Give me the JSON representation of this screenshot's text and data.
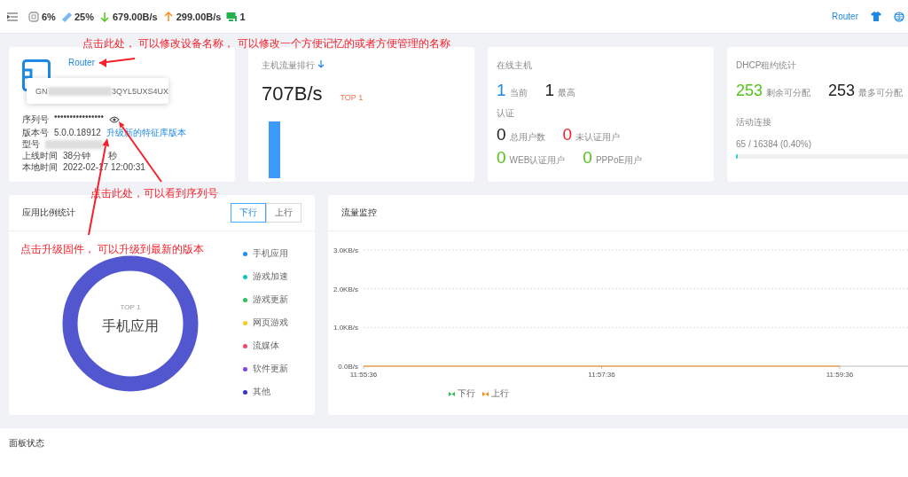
{
  "topbar": {
    "stats": [
      {
        "kind": "cpu",
        "value": "6%"
      },
      {
        "kind": "memory",
        "value": "25%"
      },
      {
        "kind": "down",
        "value": "679.00B/s"
      },
      {
        "kind": "up",
        "value": "299.00B/s"
      },
      {
        "kind": "hosts",
        "value": "1"
      }
    ],
    "device_link": "Router"
  },
  "device_card": {
    "name": "Router",
    "tooltip_start": "GN",
    "tooltip_end": "3QYL5UXS4UX",
    "rows": [
      {
        "kind": "serial",
        "label": "序列号",
        "masked_serial": "••••••••••••••••"
      },
      {
        "kind": "version",
        "label": "版本号",
        "value": "5.0.0.18912",
        "link": "升级新的特征库版本"
      },
      {
        "kind": "blurred",
        "label": "型号"
      },
      {
        "kind": "split",
        "label": "上线时间",
        "value": "38分钟",
        "value_end": "秒"
      },
      {
        "kind": "text",
        "label": "本地时间",
        "value": "2022-02-17 12:00:31"
      }
    ]
  },
  "host_traffic": {
    "title": "主机流量排行",
    "value": "707B/s",
    "badge": "TOP 1"
  },
  "online_hosts": {
    "title": "在线主机",
    "stats": [
      {
        "value": "1",
        "label": "当前",
        "color": "#1e88e5"
      },
      {
        "value": "1",
        "label": "最高",
        "color": "#222222"
      }
    ],
    "auth_title": "认证",
    "auth_stats": [
      {
        "value": "0",
        "label": "总用户数",
        "color": "#222222"
      },
      {
        "value": "0",
        "label": "未认证用户",
        "color": "#f5222d"
      },
      {
        "value": "0",
        "label": "WEB认证用户",
        "color": "#52c41a"
      },
      {
        "value": "0",
        "label": "PPPoE用户",
        "color": "#52c41a"
      }
    ]
  },
  "dhcp": {
    "title": "DHCP租约统计",
    "stats": [
      {
        "value": "253",
        "label": "剩余可分配",
        "color": "#52c41a"
      },
      {
        "value": "253",
        "label": "最多可分配",
        "color": "#222222"
      }
    ],
    "connections_title": "活动连接",
    "connections": "65 / 16384 (0.40%)",
    "level": 0.004
  },
  "app_stats": {
    "title": "应用比例统计",
    "tabs": [
      {
        "label": "下行",
        "selected": true
      },
      {
        "label": "上行",
        "selected": false
      }
    ],
    "donut_top": "TOP 1",
    "donut_label": "手机应用",
    "legend": [
      {
        "label": "手机应用",
        "color": "#1890ff"
      },
      {
        "label": "游戏加速",
        "color": "#13c2c2"
      },
      {
        "label": "游戏更新",
        "color": "#2fc25b"
      },
      {
        "label": "网页游戏",
        "color": "#facc14"
      },
      {
        "label": "流媒体",
        "color": "#f04864"
      },
      {
        "label": "软件更新",
        "color": "#8543e0"
      },
      {
        "label": "其他",
        "color": "#3436c7"
      }
    ]
  },
  "traffic_monitor": {
    "title": "流量监控",
    "chart_data": {
      "type": "line",
      "categories": [
        "11:55:36",
        "11:57:36",
        "11:59:36"
      ],
      "ylim": [
        0,
        3
      ],
      "yticks": [
        {
          "value": 0,
          "label": "0.0B/s"
        },
        {
          "value": 1,
          "label": "1.0KB/s"
        },
        {
          "value": 2,
          "label": "2.0KB/s"
        },
        {
          "value": 3,
          "label": "3.0KB/s"
        }
      ],
      "series": [
        {
          "name": "下行",
          "color": "#2fc25b",
          "values": [
            null,
            null,
            null
          ]
        },
        {
          "name": "上行",
          "color": "#fa8c16",
          "values": [
            0,
            0,
            0
          ]
        }
      ]
    }
  },
  "panel_status": {
    "title": "面板状态"
  },
  "annotations": [
    {
      "kind": "name",
      "text": "点击此处， 可以修改设备名称， 可以修改一个方便记忆的或者方便管理的名称"
    },
    {
      "kind": "serial",
      "text": "点击此处，可以看到序列号"
    },
    {
      "kind": "upgrade",
      "text": "点击升级固件， 可以升级到最新的版本"
    }
  ]
}
